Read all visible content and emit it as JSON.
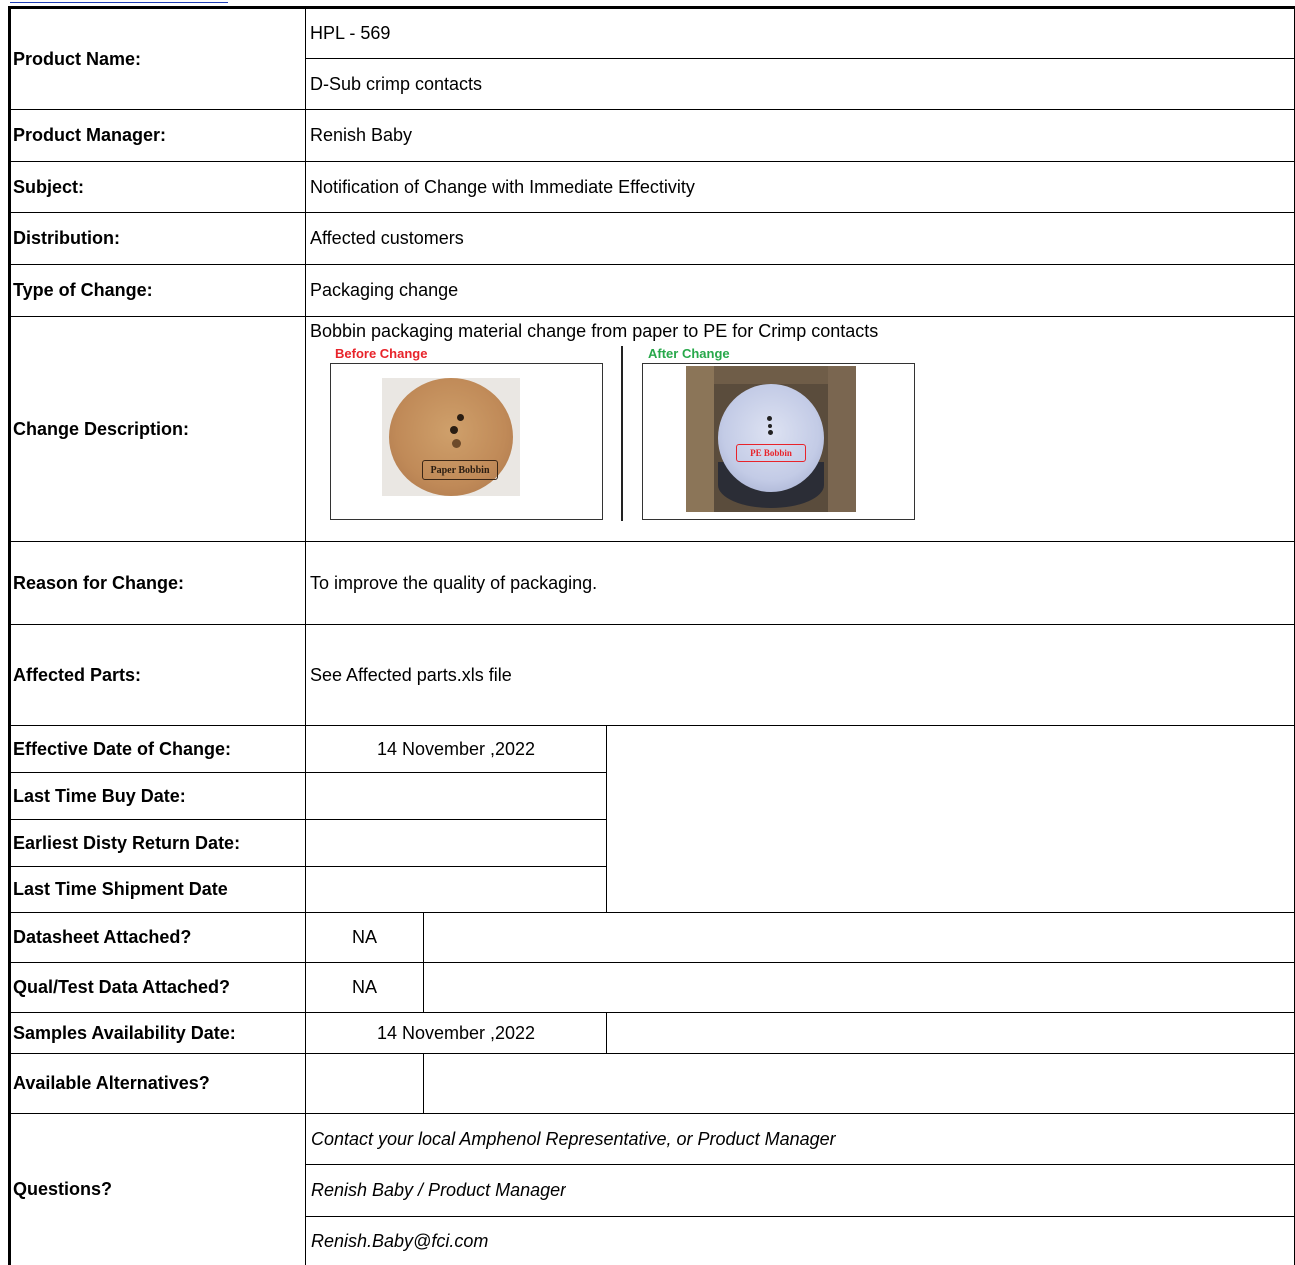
{
  "rows": {
    "product_name": {
      "label": "Product Name:",
      "values": [
        "HPL - 569",
        "D-Sub crimp contacts"
      ]
    },
    "product_manager": {
      "label": "Product Manager:",
      "value": "Renish Baby"
    },
    "subject": {
      "label": "Subject:",
      "value": "Notification of Change with Immediate Effectivity"
    },
    "distribution": {
      "label": "Distribution:",
      "value": "Affected customers"
    },
    "type_of_change": {
      "label": "Type of Change:",
      "value": "Packaging change"
    },
    "change_description": {
      "label": "Change Description:",
      "value": "Bobbin packaging material change from paper to PE for Crimp contacts",
      "before_caption": "Before Change",
      "after_caption": "After Change",
      "before_tag": "Paper Bobbin",
      "after_tag": "PE Bobbin"
    },
    "reason": {
      "label": "Reason for Change:",
      "value": "To improve the quality of packaging."
    },
    "affected_parts": {
      "label": "Affected Parts:",
      "value": "See Affected parts.xls file"
    },
    "effective_date": {
      "label": "Effective Date of Change:",
      "value": "14 November ,2022"
    },
    "last_time_buy": {
      "label": "Last Time Buy Date:",
      "value": ""
    },
    "earliest_disty_return": {
      "label": "Earliest Disty Return Date:",
      "value": ""
    },
    "last_time_shipment": {
      "label": "Last Time Shipment Date",
      "value": ""
    },
    "datasheet": {
      "label": "Datasheet Attached?",
      "value": "NA"
    },
    "qual_test": {
      "label": "Qual/Test Data Attached?",
      "value": "NA"
    },
    "samples_date": {
      "label": "Samples Availability Date:",
      "value": "14 November ,2022"
    },
    "alternatives": {
      "label": "Available Alternatives?",
      "value": ""
    },
    "questions": {
      "label": "Questions?",
      "lines": [
        "Contact your local Amphenol Representative, or Product Manager",
        "Renish Baby / Product Manager",
        "Renish.Baby@fci.com"
      ]
    }
  },
  "colors": {
    "before_caption": "#e8232a",
    "after_caption": "#27a84a",
    "link": "#1f3fb8"
  }
}
